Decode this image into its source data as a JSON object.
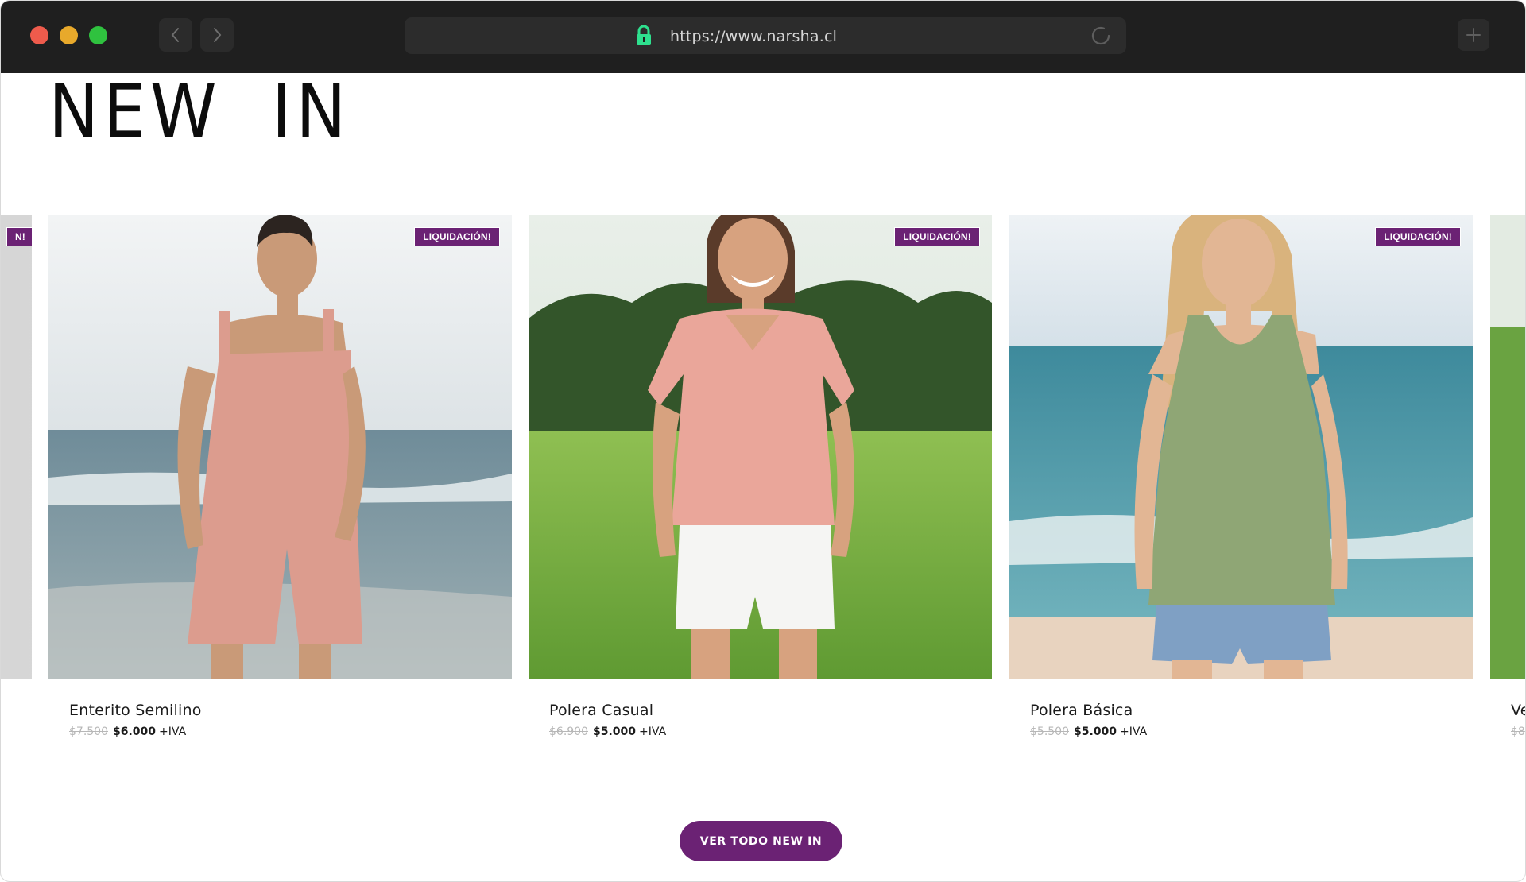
{
  "browser": {
    "url": "https://www.narsha.cl",
    "colors": {
      "chrome_bg": "#1f1f1f",
      "urlbar_bg": "#2c2c2c",
      "lock_icon": "#2ee08e"
    },
    "icons": [
      "chevron-left-icon",
      "chevron-right-icon",
      "lock-icon",
      "reload-icon",
      "plus-icon"
    ]
  },
  "section": {
    "title": "NEW IN"
  },
  "products": [
    {
      "name": "Enterito Semilino",
      "old_price": "$7.500",
      "price": "$6.000",
      "tax_note": "+IVA",
      "badge": "LIQUIDACIÓN!"
    },
    {
      "name": "Polera Casual",
      "old_price": "$6.900",
      "price": "$5.000",
      "tax_note": "+IVA",
      "badge": "LIQUIDACIÓN!"
    },
    {
      "name": "Polera Básica",
      "old_price": "$5.500",
      "price": "$5.000",
      "tax_note": "+IVA",
      "badge": "LIQUIDACIÓN!"
    }
  ],
  "partial_cards": {
    "left_badge": "N!",
    "right_name": "Ve",
    "right_old_price": "$8"
  },
  "cta": {
    "label": "VER TODO NEW IN"
  },
  "colors": {
    "accent": "#6b2274"
  }
}
